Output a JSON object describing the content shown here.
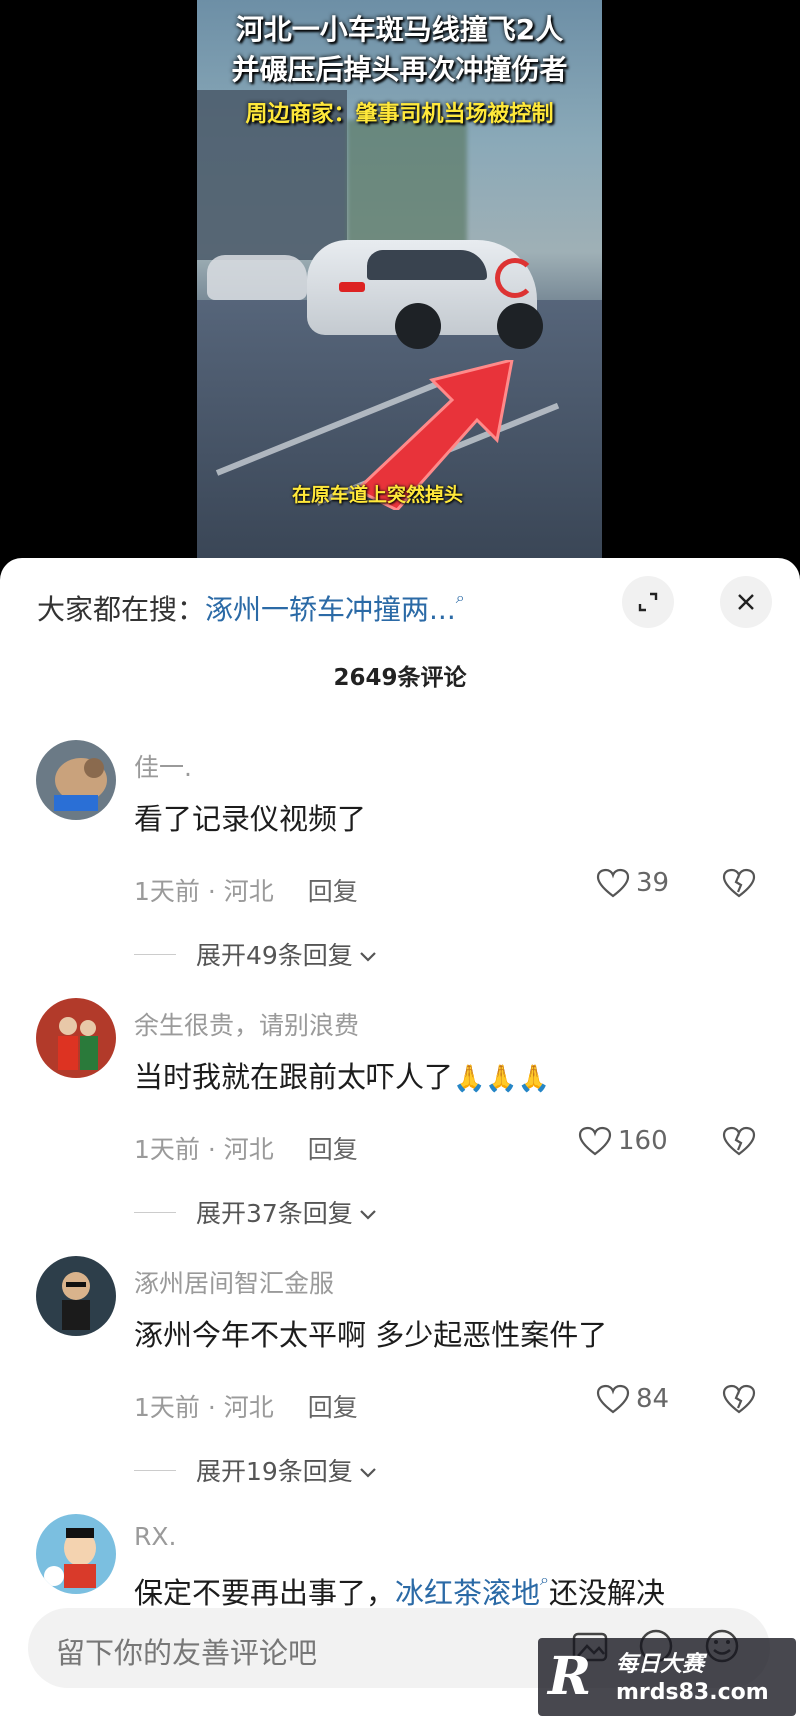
{
  "video": {
    "headline1": "河北一小车斑马线撞飞2人",
    "headline2": "并碾压后掉头再次冲撞伤者",
    "headline3": "周边商家：肇事司机当场被控制",
    "caption": "在原车道上突然掉头"
  },
  "search": {
    "label": "大家都在搜：",
    "query": "涿州一轿车冲撞两..."
  },
  "comments_count": "2649条评论",
  "comments": [
    {
      "name": "佳一.",
      "text": "看了记录仪视频了",
      "meta": "1天前 · 河北",
      "reply": "回复",
      "likes": "39",
      "expand": "展开49条回复"
    },
    {
      "name": "余生很贵，请别浪费",
      "text": "当时我就在跟前太吓人了",
      "emoji": "🙏🙏🙏",
      "meta": "1天前 · 河北",
      "reply": "回复",
      "likes": "160",
      "expand": "展开37条回复"
    },
    {
      "name": "涿州居间智汇金服",
      "text": "涿州今年不太平啊 多少起恶性案件了",
      "meta": "1天前 · 河北",
      "reply": "回复",
      "likes": "84",
      "expand": "展开19条回复"
    },
    {
      "name": "RX.",
      "text_pre": "保定不要再出事了，",
      "text_link": "冰红茶滚地",
      "text_post": "还没解决"
    }
  ],
  "input": {
    "placeholder": "留下你的友善评论吧"
  },
  "watermark": {
    "logo": "R",
    "line1": "每日大赛",
    "line2": "mrds83.com"
  }
}
